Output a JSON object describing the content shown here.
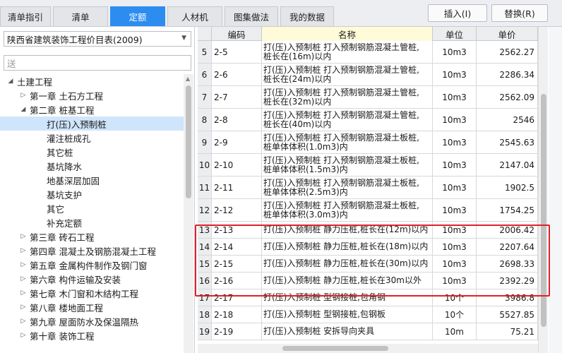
{
  "tabs": [
    {
      "label": "清单指引",
      "active": false
    },
    {
      "label": "清单",
      "active": false
    },
    {
      "label": "定额",
      "active": true
    },
    {
      "label": "人材机",
      "active": false
    },
    {
      "label": "图集做法",
      "active": false
    },
    {
      "label": "我的数据",
      "active": false
    }
  ],
  "buttons": {
    "insert": "插入(I)",
    "replace": "替换(R)"
  },
  "left": {
    "library": "陕西省建筑装饰工程价目表(2009)",
    "search_value": "送"
  },
  "tree": [
    {
      "label": "土建工程",
      "twisty": "◢",
      "level": 0,
      "selected": false
    },
    {
      "label": "第一章 土石方工程",
      "twisty": "▷",
      "level": 1,
      "selected": false
    },
    {
      "label": "第二章 桩基工程",
      "twisty": "◢",
      "level": 1,
      "selected": false
    },
    {
      "label": "打(压)入预制桩",
      "twisty": "",
      "level": 2,
      "selected": true
    },
    {
      "label": "灌注桩成孔",
      "twisty": "",
      "level": 2,
      "selected": false
    },
    {
      "label": "其它桩",
      "twisty": "",
      "level": 2,
      "selected": false
    },
    {
      "label": "基坑降水",
      "twisty": "",
      "level": 2,
      "selected": false
    },
    {
      "label": "地基深层加固",
      "twisty": "",
      "level": 2,
      "selected": false
    },
    {
      "label": "基坑支护",
      "twisty": "",
      "level": 2,
      "selected": false
    },
    {
      "label": "其它",
      "twisty": "",
      "level": 2,
      "selected": false
    },
    {
      "label": "补充定额",
      "twisty": "",
      "level": 2,
      "selected": false
    },
    {
      "label": "第三章 砖石工程",
      "twisty": "▷",
      "level": 1,
      "selected": false
    },
    {
      "label": "第四章 混凝土及钢筋混凝土工程",
      "twisty": "▷",
      "level": 1,
      "selected": false
    },
    {
      "label": "第五章 金属构件制作及钢门窗",
      "twisty": "▷",
      "level": 1,
      "selected": false
    },
    {
      "label": "第六章 构件运输及安装",
      "twisty": "▷",
      "level": 1,
      "selected": false
    },
    {
      "label": "第七章 木门窗和木结构工程",
      "twisty": "▷",
      "level": 1,
      "selected": false
    },
    {
      "label": "第八章 楼地面工程",
      "twisty": "▷",
      "level": 1,
      "selected": false
    },
    {
      "label": "第九章 屋面防水及保温隔热",
      "twisty": "▷",
      "level": 1,
      "selected": false
    },
    {
      "label": "第十章 装饰工程",
      "twisty": "▷",
      "level": 1,
      "selected": false
    }
  ],
  "table": {
    "headers": {
      "code": "编码",
      "name": "名称",
      "unit": "单位",
      "price": "单价"
    },
    "rows": [
      {
        "idx": "5",
        "code": "2-5",
        "name": "打(压)入预制桩 打入预制钢筋混凝土管桩,\n桩长在(16m)以内",
        "unit": "10m3",
        "price": "2562.27"
      },
      {
        "idx": "6",
        "code": "2-6",
        "name": "打(压)入预制桩 打入预制钢筋混凝土管桩,\n桩长在(24m)以内",
        "unit": "10m3",
        "price": "2286.34"
      },
      {
        "idx": "7",
        "code": "2-7",
        "name": "打(压)入预制桩 打入预制钢筋混凝土管桩,\n桩长在(32m)以内",
        "unit": "10m3",
        "price": "2562.09"
      },
      {
        "idx": "8",
        "code": "2-8",
        "name": "打(压)入预制桩 打入预制钢筋混凝土管桩,\n桩长在(40m)以内",
        "unit": "10m3",
        "price": "2546"
      },
      {
        "idx": "9",
        "code": "2-9",
        "name": "打(压)入预制桩 打入预制钢筋混凝土板桩,\n桩单体体积(1.0m3)内",
        "unit": "10m3",
        "price": "2545.63"
      },
      {
        "idx": "10",
        "code": "2-10",
        "name": "打(压)入预制桩 打入预制钢筋混凝土板桩,\n桩单体体积(1.5m3)内",
        "unit": "10m3",
        "price": "2147.04"
      },
      {
        "idx": "11",
        "code": "2-11",
        "name": "打(压)入预制桩 打入预制钢筋混凝土板桩,\n桩单体体积(2.5m3)内",
        "unit": "10m3",
        "price": "1902.5"
      },
      {
        "idx": "12",
        "code": "2-12",
        "name": "打(压)入预制桩 打入预制钢筋混凝土板桩,\n桩单体体积(3.0m3)内",
        "unit": "10m3",
        "price": "1754.25"
      },
      {
        "idx": "13",
        "code": "2-13",
        "name": "打(压)入预制桩 静力压桩,桩长在(12m)以内",
        "unit": "10m3",
        "price": "2006.42"
      },
      {
        "idx": "14",
        "code": "2-14",
        "name": "打(压)入预制桩 静力压桩,桩长在(18m)以内",
        "unit": "10m3",
        "price": "2207.64"
      },
      {
        "idx": "15",
        "code": "2-15",
        "name": "打(压)入预制桩 静力压桩,桩长在(30m)以内",
        "unit": "10m3",
        "price": "2698.33"
      },
      {
        "idx": "16",
        "code": "2-16",
        "name": "打(压)入预制桩 静力压桩,桩长在30m以外",
        "unit": "10m3",
        "price": "2392.29"
      },
      {
        "idx": "17",
        "code": "2-17",
        "name": "打(压)入预制桩 型钢接桩,包角钢",
        "unit": "10个",
        "price": "3986.8"
      },
      {
        "idx": "18",
        "code": "2-18",
        "name": "打(压)入预制桩 型钢接桩,包钢板",
        "unit": "10个",
        "price": "5527.85"
      },
      {
        "idx": "19",
        "code": "2-19",
        "name": "打(压)入预制桩 安拆导向夹具",
        "unit": "10m",
        "price": "75.21"
      }
    ]
  }
}
